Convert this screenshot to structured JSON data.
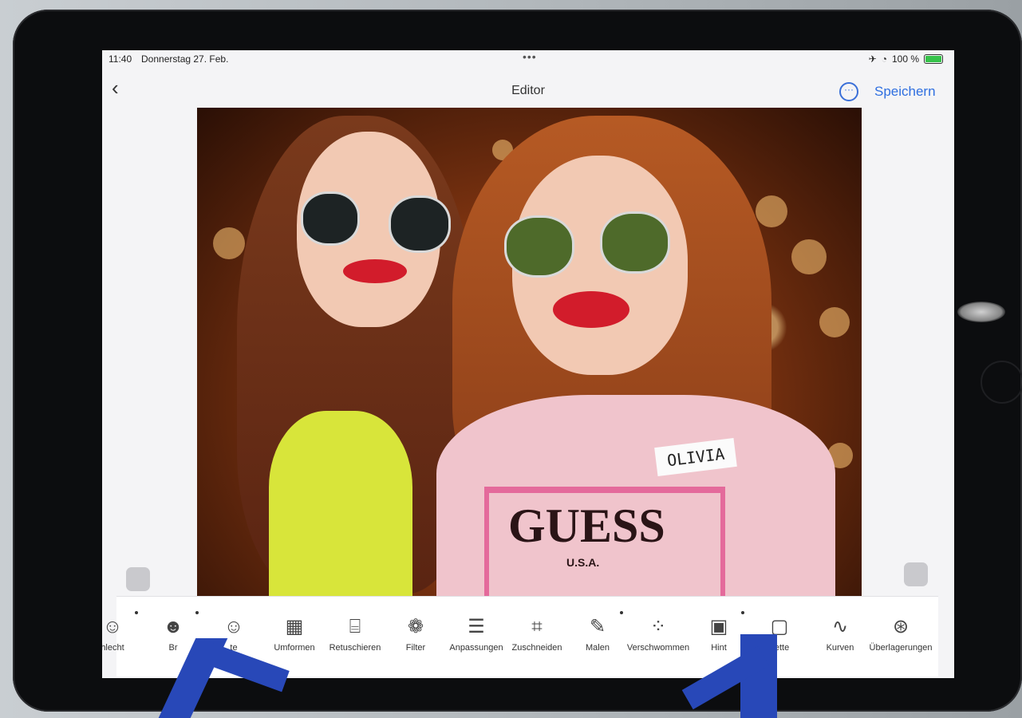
{
  "status_bar": {
    "time": "11:40",
    "date": "Donnerstag 27. Feb.",
    "battery": "100 %"
  },
  "nav": {
    "back_icon": "chevron-left-icon",
    "title": "Editor",
    "more_icon": "ellipsis-circle-icon",
    "save_label": "Speichern"
  },
  "photo": {
    "tag_text": "OLIVIA",
    "shirt_logo": "GUESS",
    "shirt_sub": "U.S.A."
  },
  "toolbar": {
    "tools": [
      {
        "label": "hlecht",
        "icon": "face-avatar-icon",
        "dot": true
      },
      {
        "label": "Br",
        "icon": "face-glasses-icon",
        "dot": true
      },
      {
        "label": "te",
        "icon": "face-beard-icon",
        "dot": false
      },
      {
        "label": "Umformen",
        "icon": "grid-icon",
        "dot": false
      },
      {
        "label": "Retuschieren",
        "icon": "bandage-icon",
        "dot": false
      },
      {
        "label": "Filter",
        "icon": "circles-icon",
        "dot": false
      },
      {
        "label": "Anpassungen",
        "icon": "sliders-icon",
        "dot": false
      },
      {
        "label": "Zuschneiden",
        "icon": "crop-icon",
        "dot": false
      },
      {
        "label": "Malen",
        "icon": "brush-icon",
        "dot": true
      },
      {
        "label": "Verschwommen",
        "icon": "blur-dots-icon",
        "dot": false
      },
      {
        "label": "Hint",
        "icon": "image-icon",
        "dot": true
      },
      {
        "label": "nette",
        "icon": "vignette-icon",
        "dot": false
      },
      {
        "label": "Kurven",
        "icon": "curve-icon",
        "dot": false
      },
      {
        "label": "Überlagerungen",
        "icon": "overlay-icon",
        "dot": false
      }
    ]
  }
}
